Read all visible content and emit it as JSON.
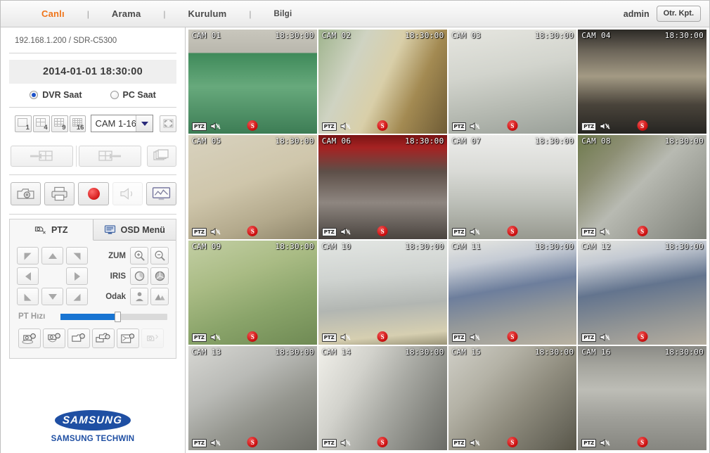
{
  "header": {
    "nav": [
      {
        "label": "Canlı",
        "active": true
      },
      {
        "label": "Arama",
        "active": false
      },
      {
        "label": "Kurulum",
        "active": false
      },
      {
        "label": "Bilgi",
        "active": false
      }
    ],
    "separator": "|",
    "user": "admin",
    "logout_label": "Otr. Kpt.",
    "accent_color": "#ef7419"
  },
  "sidebar": {
    "device_info": "192.168.1.200 / SDR-C5300",
    "clock": "2014-01-01 18:30:00",
    "time_source": {
      "dvr_label": "DVR Saat",
      "pc_label": "PC Saat",
      "selected": "DVR Saat"
    },
    "layout_buttons": [
      {
        "label": "1",
        "name": "layout-1"
      },
      {
        "label": "4",
        "name": "layout-4"
      },
      {
        "label": "9",
        "name": "layout-9"
      },
      {
        "label": "16",
        "name": "layout-16"
      }
    ],
    "camera_group": {
      "selected": "CAM 1-16",
      "options": [
        "CAM 1-16"
      ]
    },
    "fullscreen_icon": "fullscreen-icon",
    "sequence_buttons": [
      {
        "name": "prev-group-button",
        "icon": "grid-arrow-left-icon"
      },
      {
        "name": "next-group-button",
        "icon": "grid-arrow-right-icon"
      },
      {
        "name": "sequence-button",
        "icon": "layers-icon"
      }
    ],
    "control_buttons": [
      {
        "name": "snapshot-button",
        "icon": "camera-icon",
        "disabled": false
      },
      {
        "name": "print-button",
        "icon": "printer-icon",
        "disabled": false
      },
      {
        "name": "record-button",
        "icon": "record-dot-icon",
        "disabled": false
      },
      {
        "name": "audio-button",
        "icon": "speaker-icon",
        "disabled": true
      },
      {
        "name": "monitor-button",
        "icon": "monitor-icon",
        "disabled": false
      }
    ],
    "ptz": {
      "tabs": [
        {
          "label": "PTZ",
          "icon": "ptz-camera-icon",
          "active": true
        },
        {
          "label": "OSD Menü",
          "icon": "osd-monitor-icon",
          "active": false
        }
      ],
      "zoom_label": "ZUM",
      "iris_label": "IRIS",
      "focus_label": "Odak",
      "speed_label": "PT Hızı",
      "speed_percent": 53,
      "zoom_in_icon": "zoom-in-icon",
      "zoom_out_icon": "zoom-out-icon",
      "iris_open_icon": "iris-open-icon",
      "iris_close_icon": "iris-close-icon",
      "focus_near_icon": "focus-near-icon",
      "focus_far_icon": "focus-far-icon",
      "preset_buttons": [
        {
          "name": "preset-go-button",
          "icon": "camera-preset-icon",
          "disabled": false
        },
        {
          "name": "preset-set-button",
          "icon": "camera-preset-set-icon",
          "disabled": false
        },
        {
          "name": "tour-start-button",
          "icon": "camera-tour-icon",
          "disabled": false
        },
        {
          "name": "tour-stop-button",
          "icon": "camera-tour-stop-icon",
          "disabled": false
        },
        {
          "name": "pattern-button",
          "icon": "camera-pattern-icon",
          "disabled": false
        },
        {
          "name": "auto-pan-button",
          "icon": "camera-autopan-icon",
          "disabled": true
        }
      ]
    },
    "brand": {
      "logo_text": "SAMSUNG",
      "sub_text": "SAMSUNG TECHWIN",
      "color": "#1f4fa3"
    }
  },
  "grid": {
    "columns": 4,
    "rows": 4,
    "overlay": {
      "ptz_badge": "PTZ",
      "mute_icon": "speaker-muted-icon",
      "record_badge": "S"
    },
    "tiles": [
      {
        "label": "CAM 01",
        "time": "18:30:00",
        "scene": "parking-garage-white-van"
      },
      {
        "label": "CAM 02",
        "time": "18:30:00",
        "scene": "lobby-glass-door"
      },
      {
        "label": "CAM 03",
        "time": "18:30:00",
        "scene": "entrance-corridor"
      },
      {
        "label": "CAM 04",
        "time": "18:30:00",
        "scene": "garage-ramp-car"
      },
      {
        "label": "CAM 05",
        "time": "18:30:00",
        "scene": "stairwell-railing"
      },
      {
        "label": "CAM 06",
        "time": "18:30:00",
        "scene": "garage-red-light-cars"
      },
      {
        "label": "CAM 07",
        "time": "18:30:00",
        "scene": "indoor-hallway"
      },
      {
        "label": "CAM 08",
        "time": "18:30:00",
        "scene": "outdoor-parking-lot"
      },
      {
        "label": "CAM 09",
        "time": "18:30:00",
        "scene": "green-corridor-doors"
      },
      {
        "label": "CAM 10",
        "time": "18:30:00",
        "scene": "elevator-lobby"
      },
      {
        "label": "CAM 11",
        "time": "18:30:00",
        "scene": "office-cubicles-a"
      },
      {
        "label": "CAM 12",
        "time": "18:30:00",
        "scene": "office-cubicles-b"
      },
      {
        "label": "CAM 13",
        "time": "18:30:00",
        "scene": "concrete-stairs"
      },
      {
        "label": "CAM 14",
        "time": "18:30:00",
        "scene": "double-doors-grey"
      },
      {
        "label": "CAM 15",
        "time": "18:30:00",
        "scene": "elevator-interior"
      },
      {
        "label": "CAM 16",
        "time": "18:30:00",
        "scene": "street-white-car"
      }
    ]
  }
}
